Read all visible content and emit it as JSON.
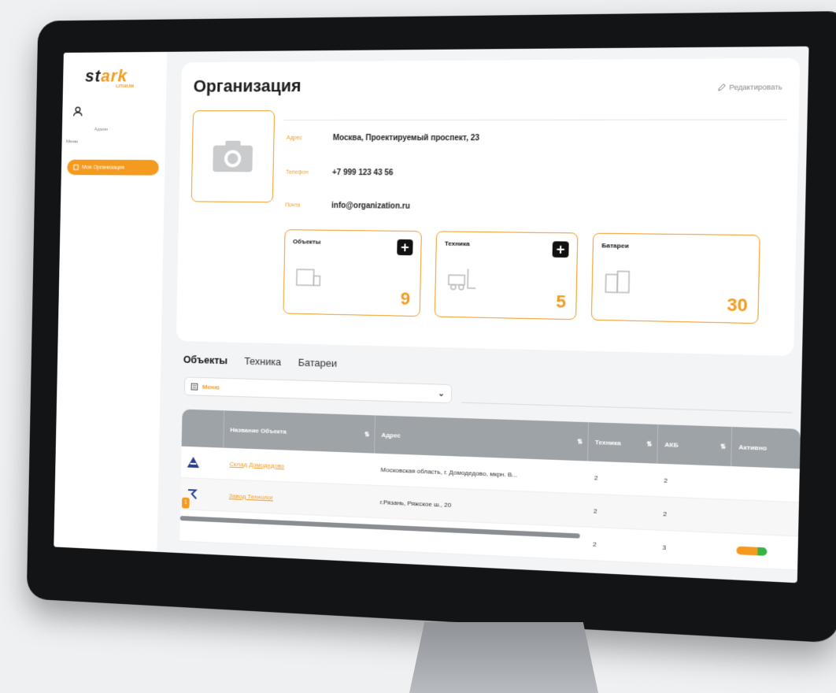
{
  "brand": {
    "name_part1": "st",
    "name_part2": "ark",
    "sub": "LITHIUM"
  },
  "sidebar": {
    "user_role": "Админ",
    "menu_label": "Меню",
    "menu_button": "Моя Организация"
  },
  "org": {
    "title": "Организация",
    "edit_label": "Редактировать",
    "address_key": "Адрес",
    "address_value": "Москва, Проектируемый проспект, 23",
    "phone_key": "Телефон",
    "phone_value": "+7 999 123 43 56",
    "mail_key": "Почта",
    "mail_value": "info@organization.ru"
  },
  "stats": [
    {
      "title": "Объекты",
      "count": "9",
      "icon": "warehouse-icon"
    },
    {
      "title": "Техника",
      "count": "5",
      "icon": "forklift-icon"
    },
    {
      "title": "Батареи",
      "count": "30",
      "icon": "battery-icon"
    }
  ],
  "tabs": [
    "Объекты",
    "Техника",
    "Батареи"
  ],
  "filter": {
    "label": "Меню"
  },
  "table": {
    "headers": [
      "Название Объекта",
      "Адрес",
      "Техника",
      "АКБ",
      "Активно"
    ],
    "rows": [
      {
        "name": "Склад Домодедово",
        "address": "Московская область, г. Домодедово, мкрн. В...",
        "tech": "2",
        "akb": "2"
      },
      {
        "name": "Завод Технолог",
        "address": "г.Рязань, Ряжское ш., 20",
        "tech": "2",
        "akb": "2"
      },
      {
        "name": "",
        "address": "",
        "tech": "2",
        "akb": "3"
      }
    ],
    "pager": "1"
  },
  "colors": {
    "accent": "#f39a1f",
    "header": "#9ea3a8",
    "ok": "#36b34a"
  }
}
